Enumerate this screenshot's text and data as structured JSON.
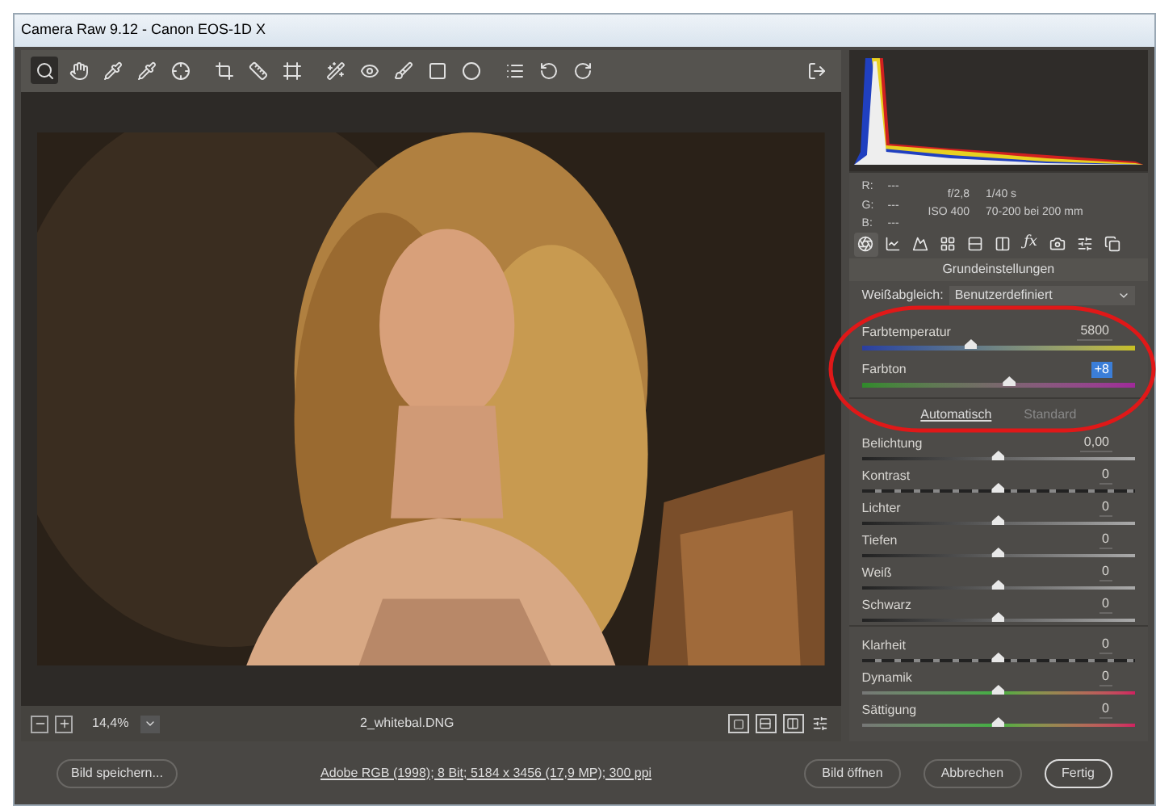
{
  "window": {
    "title": "Camera Raw 9.12 - Canon EOS-1D X"
  },
  "toolbar": {
    "tools": [
      {
        "selected": true
      },
      {
        "selected": false
      },
      {
        "selected": false
      },
      {
        "selected": false
      },
      {
        "selected": false
      },
      {
        "selected": false
      },
      {
        "selected": false
      },
      {
        "selected": false
      },
      {
        "selected": false
      },
      {
        "selected": false
      },
      {
        "selected": false
      },
      {
        "selected": false
      },
      {
        "selected": false
      },
      {
        "selected": false
      },
      {
        "selected": false
      },
      {
        "selected": false
      }
    ]
  },
  "info": {
    "rgb": [
      {
        "label": "R:",
        "value": "---"
      },
      {
        "label": "G:",
        "value": "---"
      },
      {
        "label": "B:",
        "value": "---"
      }
    ],
    "aperture": "f/2,8",
    "shutter": "1/40 s",
    "iso": "ISO 400",
    "lens": "70-200 bei 200 mm"
  },
  "panel_tabs": [
    {
      "selected": true
    },
    {
      "selected": false
    },
    {
      "selected": false
    },
    {
      "selected": false
    },
    {
      "selected": false
    },
    {
      "selected": false
    },
    {
      "selected": false,
      "glyph": "ƒx"
    },
    {
      "selected": false
    },
    {
      "selected": false
    },
    {
      "selected": false
    }
  ],
  "panel": {
    "title": "Grundeinstellungen",
    "white_balance": {
      "label": "Weißabgleich:",
      "value": "Benutzerdefiniert"
    }
  },
  "slider_sections": [
    {
      "sliders": [
        {
          "label": "Farbtemperatur",
          "value": "5800",
          "level": 0.4,
          "kind": "temperature",
          "highlighted": false
        },
        {
          "label": "Farbton",
          "value": "+8",
          "level": 0.54,
          "kind": "tint",
          "highlighted": true
        }
      ]
    },
    {
      "links": [
        "Automatisch",
        "Standard"
      ],
      "sliders": [
        {
          "label": "Belichtung",
          "value": "0,00",
          "level": 0.5,
          "kind": "plain",
          "highlighted": false
        },
        {
          "label": "Kontrast",
          "value": "0",
          "level": 0.5,
          "kind": "dashed",
          "highlighted": false
        },
        {
          "label": "Lichter",
          "value": "0",
          "level": 0.5,
          "kind": "plain",
          "highlighted": false
        },
        {
          "label": "Tiefen",
          "value": "0",
          "level": 0.5,
          "kind": "plain",
          "highlighted": false
        },
        {
          "label": "Weiß",
          "value": "0",
          "level": 0.5,
          "kind": "plain",
          "highlighted": false
        },
        {
          "label": "Schwarz",
          "value": "0",
          "level": 0.5,
          "kind": "plain",
          "highlighted": false
        }
      ]
    },
    {
      "sliders": [
        {
          "label": "Klarheit",
          "value": "0",
          "level": 0.5,
          "kind": "dashed",
          "highlighted": false
        },
        {
          "label": "Dynamik",
          "value": "0",
          "level": 0.5,
          "kind": "spectrum",
          "highlighted": false
        },
        {
          "label": "Sättigung",
          "value": "0",
          "level": 0.5,
          "kind": "spectrum",
          "highlighted": false
        }
      ]
    }
  ],
  "image_bar": {
    "zoom": "14,4%",
    "filename": "2_whitebal.DNG"
  },
  "footer": {
    "save": "Bild speichern...",
    "workflow_link": "Adobe RGB (1998); 8 Bit; 5184 x 3456 (17,9 MP); 300 ppi",
    "buttons": [
      {
        "label": "Bild öffnen",
        "primary": false
      },
      {
        "label": "Abbrechen",
        "primary": false
      },
      {
        "label": "Fertig",
        "primary": true
      }
    ]
  }
}
